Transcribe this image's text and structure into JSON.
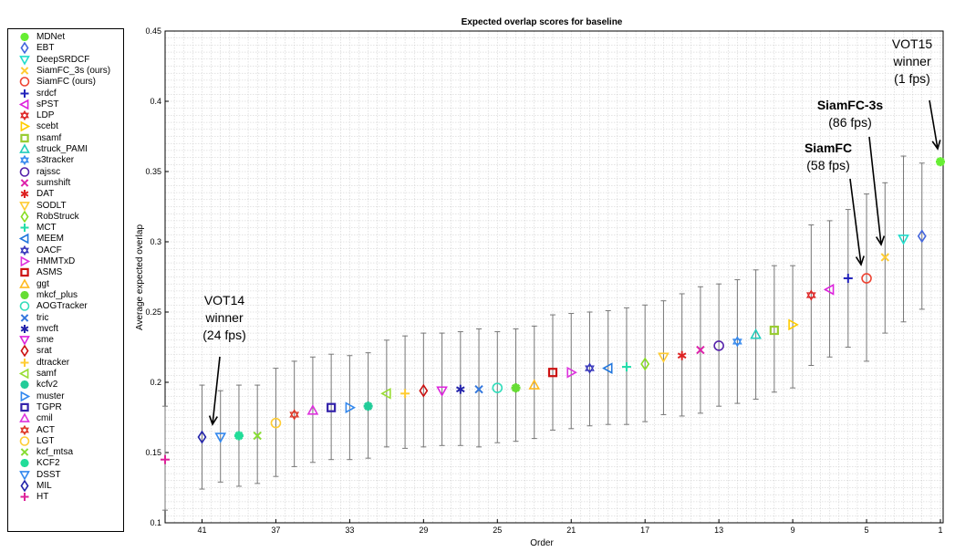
{
  "chart_data": {
    "type": "scatter",
    "title": "Expected overlap scores for baseline",
    "xlabel": "Order",
    "ylabel": "Average expected overlap",
    "ylim": [
      0.1,
      0.45
    ],
    "xlim": [
      43,
      1
    ],
    "x_reversed": true,
    "grid": true,
    "legend_position": "left",
    "x_ticks": [
      41,
      37,
      33,
      29,
      25,
      21,
      17,
      13,
      9,
      5,
      1
    ],
    "y_ticks": [
      0.1,
      0.15,
      0.2,
      0.25,
      0.3,
      0.35,
      0.4,
      0.45
    ],
    "series": [
      {
        "name": "MDNet",
        "order": 1,
        "value": 0.357,
        "low": 0.357,
        "high": 0.357,
        "marker": "asterisk8",
        "color": "#66ee33"
      },
      {
        "name": "EBT",
        "order": 2,
        "value": 0.304,
        "low": 0.252,
        "high": 0.356,
        "marker": "diamond",
        "color": "#4466dd"
      },
      {
        "name": "DeepSRDCF",
        "order": 3,
        "value": 0.302,
        "low": 0.243,
        "high": 0.361,
        "marker": "triangle-down",
        "color": "#22ddcc"
      },
      {
        "name": "SiamFC_3s (ours)",
        "order": 4,
        "value": 0.289,
        "low": 0.235,
        "high": 0.342,
        "marker": "x",
        "color": "#ffcc33"
      },
      {
        "name": "SiamFC (ours)",
        "order": 5,
        "value": 0.274,
        "low": 0.215,
        "high": 0.334,
        "marker": "circle",
        "color": "#ee4433"
      },
      {
        "name": "srdcf",
        "order": 6,
        "value": 0.274,
        "low": 0.225,
        "high": 0.323,
        "marker": "plus",
        "color": "#2222bb"
      },
      {
        "name": "sPST",
        "order": 7,
        "value": 0.266,
        "low": 0.218,
        "high": 0.315,
        "marker": "triangle-left",
        "color": "#dd22dd"
      },
      {
        "name": "LDP",
        "order": 8,
        "value": 0.262,
        "low": 0.212,
        "high": 0.312,
        "marker": "hexagram",
        "color": "#dd2222"
      },
      {
        "name": "scebt",
        "order": 9,
        "value": 0.241,
        "low": 0.196,
        "high": 0.283,
        "marker": "triangle-right",
        "color": "#ffcc00"
      },
      {
        "name": "nsamf",
        "order": 10,
        "value": 0.237,
        "low": 0.193,
        "high": 0.283,
        "marker": "square",
        "color": "#99cc33"
      },
      {
        "name": "struck_PAMI",
        "order": 11,
        "value": 0.234,
        "low": 0.188,
        "high": 0.28,
        "marker": "triangle-up",
        "color": "#22ccbb"
      },
      {
        "name": "s3tracker",
        "order": 12,
        "value": 0.229,
        "low": 0.185,
        "high": 0.273,
        "marker": "hexagram",
        "color": "#3388ee"
      },
      {
        "name": "rajssc",
        "order": 13,
        "value": 0.226,
        "low": 0.183,
        "high": 0.27,
        "marker": "circle",
        "color": "#5522aa"
      },
      {
        "name": "sumshift",
        "order": 14,
        "value": 0.223,
        "low": 0.178,
        "high": 0.268,
        "marker": "x",
        "color": "#dd22aa"
      },
      {
        "name": "DAT",
        "order": 15,
        "value": 0.219,
        "low": 0.176,
        "high": 0.263,
        "marker": "asterisk",
        "color": "#dd2222"
      },
      {
        "name": "SODLT",
        "order": 16,
        "value": 0.218,
        "low": 0.177,
        "high": 0.258,
        "marker": "triangle-down",
        "color": "#ffcc33"
      },
      {
        "name": "RobStruck",
        "order": 17,
        "value": 0.213,
        "low": 0.172,
        "high": 0.255,
        "marker": "diamond",
        "color": "#88dd22"
      },
      {
        "name": "MCT",
        "order": 18,
        "value": 0.211,
        "low": 0.17,
        "high": 0.253,
        "marker": "plus",
        "color": "#22ddaa"
      },
      {
        "name": "MEEM",
        "order": 19,
        "value": 0.21,
        "low": 0.17,
        "high": 0.251,
        "marker": "triangle-left",
        "color": "#2277dd"
      },
      {
        "name": "OACF",
        "order": 20,
        "value": 0.21,
        "low": 0.169,
        "high": 0.25,
        "marker": "hexagram",
        "color": "#3333bb"
      },
      {
        "name": "HMMTxD",
        "order": 21,
        "value": 0.207,
        "low": 0.167,
        "high": 0.249,
        "marker": "triangle-right",
        "color": "#dd33dd"
      },
      {
        "name": "ASMS",
        "order": 22,
        "value": 0.207,
        "low": 0.166,
        "high": 0.248,
        "marker": "square",
        "color": "#cc1111"
      },
      {
        "name": "ggt",
        "order": 23,
        "value": 0.198,
        "low": 0.16,
        "high": 0.24,
        "marker": "triangle-up",
        "color": "#ffbb22"
      },
      {
        "name": "mkcf_plus",
        "order": 24,
        "value": 0.196,
        "low": 0.158,
        "high": 0.238,
        "marker": "asterisk8",
        "color": "#66dd33"
      },
      {
        "name": "AOGTracker",
        "order": 25,
        "value": 0.196,
        "low": 0.157,
        "high": 0.236,
        "marker": "circle",
        "color": "#33ddbb"
      },
      {
        "name": "tric",
        "order": 26,
        "value": 0.195,
        "low": 0.154,
        "high": 0.238,
        "marker": "x",
        "color": "#3377dd"
      },
      {
        "name": "mvcft",
        "order": 27,
        "value": 0.195,
        "low": 0.155,
        "high": 0.236,
        "marker": "asterisk",
        "color": "#2222aa"
      },
      {
        "name": "sme",
        "order": 28,
        "value": 0.194,
        "low": 0.155,
        "high": 0.235,
        "marker": "triangle-down",
        "color": "#dd22dd"
      },
      {
        "name": "srat",
        "order": 29,
        "value": 0.194,
        "low": 0.154,
        "high": 0.235,
        "marker": "diamond",
        "color": "#cc1111"
      },
      {
        "name": "dtracker",
        "order": 30,
        "value": 0.192,
        "low": 0.153,
        "high": 0.233,
        "marker": "plus",
        "color": "#ffcc33"
      },
      {
        "name": "samf",
        "order": 31,
        "value": 0.192,
        "low": 0.154,
        "high": 0.23,
        "marker": "triangle-left",
        "color": "#99dd33"
      },
      {
        "name": "kcfv2",
        "order": 32,
        "value": 0.183,
        "low": 0.146,
        "high": 0.221,
        "marker": "asterisk8",
        "color": "#22cc99"
      },
      {
        "name": "muster",
        "order": 33,
        "value": 0.182,
        "low": 0.145,
        "high": 0.219,
        "marker": "triangle-right",
        "color": "#3388ee"
      },
      {
        "name": "TGPR",
        "order": 34,
        "value": 0.182,
        "low": 0.145,
        "high": 0.22,
        "marker": "square",
        "color": "#3322aa"
      },
      {
        "name": "cmil",
        "order": 35,
        "value": 0.18,
        "low": 0.143,
        "high": 0.218,
        "marker": "triangle-up",
        "color": "#dd33dd"
      },
      {
        "name": "ACT",
        "order": 36,
        "value": 0.177,
        "low": 0.14,
        "high": 0.215,
        "marker": "hexagram",
        "color": "#dd3322"
      },
      {
        "name": "LGT",
        "order": 37,
        "value": 0.171,
        "low": 0.133,
        "high": 0.21,
        "marker": "circle",
        "color": "#ffcc33"
      },
      {
        "name": "kcf_mtsa",
        "order": 38,
        "value": 0.162,
        "low": 0.128,
        "high": 0.198,
        "marker": "x",
        "color": "#88dd33"
      },
      {
        "name": "KCF2",
        "order": 39,
        "value": 0.162,
        "low": 0.126,
        "high": 0.198,
        "marker": "asterisk8",
        "color": "#22dd99"
      },
      {
        "name": "DSST",
        "order": 40,
        "value": 0.161,
        "low": 0.129,
        "high": 0.194,
        "marker": "triangle-down",
        "color": "#3388ee"
      },
      {
        "name": "MIL",
        "order": 41,
        "value": 0.161,
        "low": 0.124,
        "high": 0.198,
        "marker": "diamond",
        "color": "#2222aa"
      },
      {
        "name": "HT",
        "order": 43,
        "value": 0.145,
        "low": 0.109,
        "high": 0.183,
        "marker": "plus",
        "color": "#dd2299"
      }
    ],
    "annotations": [
      {
        "lines": [
          "VOT15",
          "winner",
          "(1 fps)"
        ],
        "bold": false,
        "target_order": 1,
        "target_value": 0.357
      },
      {
        "lines": [
          "SiamFC-3s",
          "(86 fps)"
        ],
        "bold_first": true,
        "target_order": 4,
        "target_value": 0.289
      },
      {
        "lines": [
          "SiamFC",
          "(58 fps)"
        ],
        "bold_first": true,
        "target_order": 5,
        "target_value": 0.274
      },
      {
        "lines": [
          "VOT14",
          "winner",
          "(24 fps)"
        ],
        "bold": false,
        "target_order": 40,
        "target_value": 0.161
      }
    ]
  }
}
